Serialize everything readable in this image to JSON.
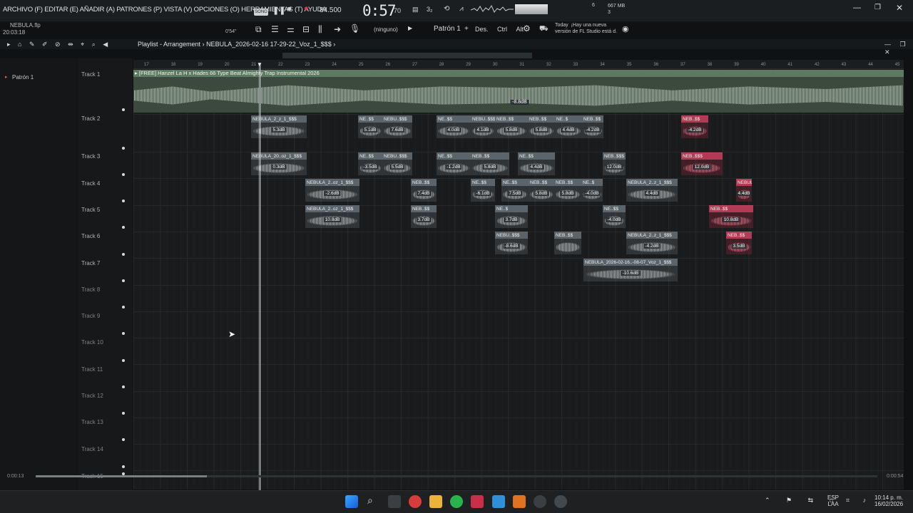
{
  "menubar": {
    "menu_text": "ARCHIVO (F) EDITAR (E) AÑADIR (A) PATRONES (P) VISTA (V) OPCIONES (O) HERRAMIENTAS (T) AYUDA",
    "file_name": "NEBULA.flp",
    "file_time": "20:03:18",
    "song_badge": "SONG",
    "tempo": "84.500",
    "clock": "0:57",
    "clock_ms": "70",
    "cpu": "6",
    "memory": "667 MB",
    "memory_sub": "3",
    "none_label": "(ninguno)",
    "pattern": "Patrón 1",
    "mode_des": "Des.",
    "mode_ctrl": "Ctrl",
    "mode_alt": "Alt",
    "news_today": "Today",
    "news_line1": "¡Hay una nueva",
    "news_line2": "versión de FL Studio está d.",
    "time_small": "0'54\""
  },
  "playlist": {
    "title": "Playlist - Arrangement",
    "arrangement": "NEBULA_2026-02-16 17-29-22_Voz_1_$$$",
    "pattern_item": "Patrón 1"
  },
  "ruler": [
    "17",
    "18",
    "19",
    "20",
    "21",
    "22",
    "23",
    "24",
    "25",
    "26",
    "27",
    "28",
    "29",
    "30",
    "31",
    "32",
    "33",
    "34",
    "35",
    "36",
    "37",
    "38",
    "39",
    "40",
    "41",
    "42",
    "43",
    "44",
    "45"
  ],
  "tracks": [
    "Track 1",
    "Track 2",
    "Track 3",
    "Track 4",
    "Track 5",
    "Track 6",
    "Track 7",
    "Track 8",
    "Track 9",
    "Track 10",
    "Track 11",
    "Track 12",
    "Track 13",
    "Track 14",
    "Track 15"
  ],
  "main_clip": {
    "title": "[FREE] Hanzel La H x Hades 66 Type Beat Almighty  Trap Instrumental 2026",
    "db": "-8.8dB"
  },
  "clips": {
    "t2a": {
      "name": "NEBULA_2_z_1_$$$",
      "db": "5.3dB"
    },
    "t2b": {
      "name": "NE..$$",
      "db": "5.1dB"
    },
    "t2c": {
      "name": "NEBU..$$$",
      "db": "7.6dB"
    },
    "t2d": {
      "name": "NE..$$",
      "db": "4.0dB"
    },
    "t2e": {
      "name": "NEBU..$$$",
      "db": "4.1dB"
    },
    "t2f": {
      "name": "NEB..$$",
      "db": "5.8dB"
    },
    "t2g": {
      "name": "NEB..$$",
      "db": "5.8dB"
    },
    "t2h": {
      "name": "NE..$",
      "db": "4.4dB"
    },
    "t2i": {
      "name": "NEB..$$",
      "db": "-4.2dB"
    },
    "t3a": {
      "name": "NEBULA_20..oz_1_$$$",
      "db": "0.3dB"
    },
    "t3b": {
      "name": "NE..$$",
      "db": "-3.5dB"
    },
    "t3c": {
      "name": "NEBU..$$$",
      "db": "5.5dB"
    },
    "t3d": {
      "name": "NE..$$",
      "db": "-1.2dB"
    },
    "t3e": {
      "name": "NEB..$$",
      "db": "5.8dB"
    },
    "t3f": {
      "name": "NE..$$",
      "db": "4.4dB"
    },
    "t3g": {
      "name": "NEB..$$$",
      "db": "12.0dB"
    },
    "t4a": {
      "name": "NEBULA_2..oz_1_$$$",
      "db": "-2.6dB"
    },
    "t4b": {
      "name": "NEB..$$",
      "db": "7.4dB"
    },
    "t4c": {
      "name": "NE..$$",
      "db": "-6.1dB"
    },
    "t4d": {
      "name": "NE..$$",
      "db": "7.5dB"
    },
    "t4e": {
      "name": "NEB..$$",
      "db": "5.8dB"
    },
    "t4f": {
      "name": "NEB..$$",
      "db": "5.8dB"
    },
    "t4g": {
      "name": "NE..$",
      "db": "-4.0dB"
    },
    "t4h": {
      "name": "NEBULA_2..z_1_$$$",
      "db": "4.4dB"
    },
    "t5a": {
      "name": "NEBULA_2..oz_1_$$$",
      "db": "10.8dB"
    },
    "t5b": {
      "name": "NEB..$$",
      "db": "3.7dB"
    },
    "t5c": {
      "name": "NE..$",
      "db": "3.7dB"
    },
    "t5d": {
      "name": "NE..$$",
      "db": "-4.0dB"
    },
    "t5e": {
      "name": "NEB..$$",
      "db": "10.8dB"
    },
    "t6a": {
      "name": "NEBU..$$$",
      "db": "-8.6dB"
    },
    "t6b": {
      "name": "NEB..$$",
      "db": ""
    },
    "t6c": {
      "name": "NEBULA_2..z_1_$$$",
      "db": "-4.2dB"
    },
    "t6d": {
      "name": "NEB..$$",
      "db": "3.5dB"
    },
    "t7a": {
      "name": "NEBULA_2026-02-16..-08-07_Voz_1_$$$",
      "db": "-10.6dB"
    }
  },
  "footer": {
    "time_left": "0:00:13",
    "time_right": "0:00:54"
  },
  "taskbar": {
    "lang1": "ESP",
    "lang2": "LAA",
    "time": "10:14 p. m.",
    "date": "16/02/2026"
  },
  "colors": {
    "accent": "#b33a55",
    "clip": "#5a646a",
    "main_clip": "#5f7a63",
    "background": "#191b1d"
  }
}
